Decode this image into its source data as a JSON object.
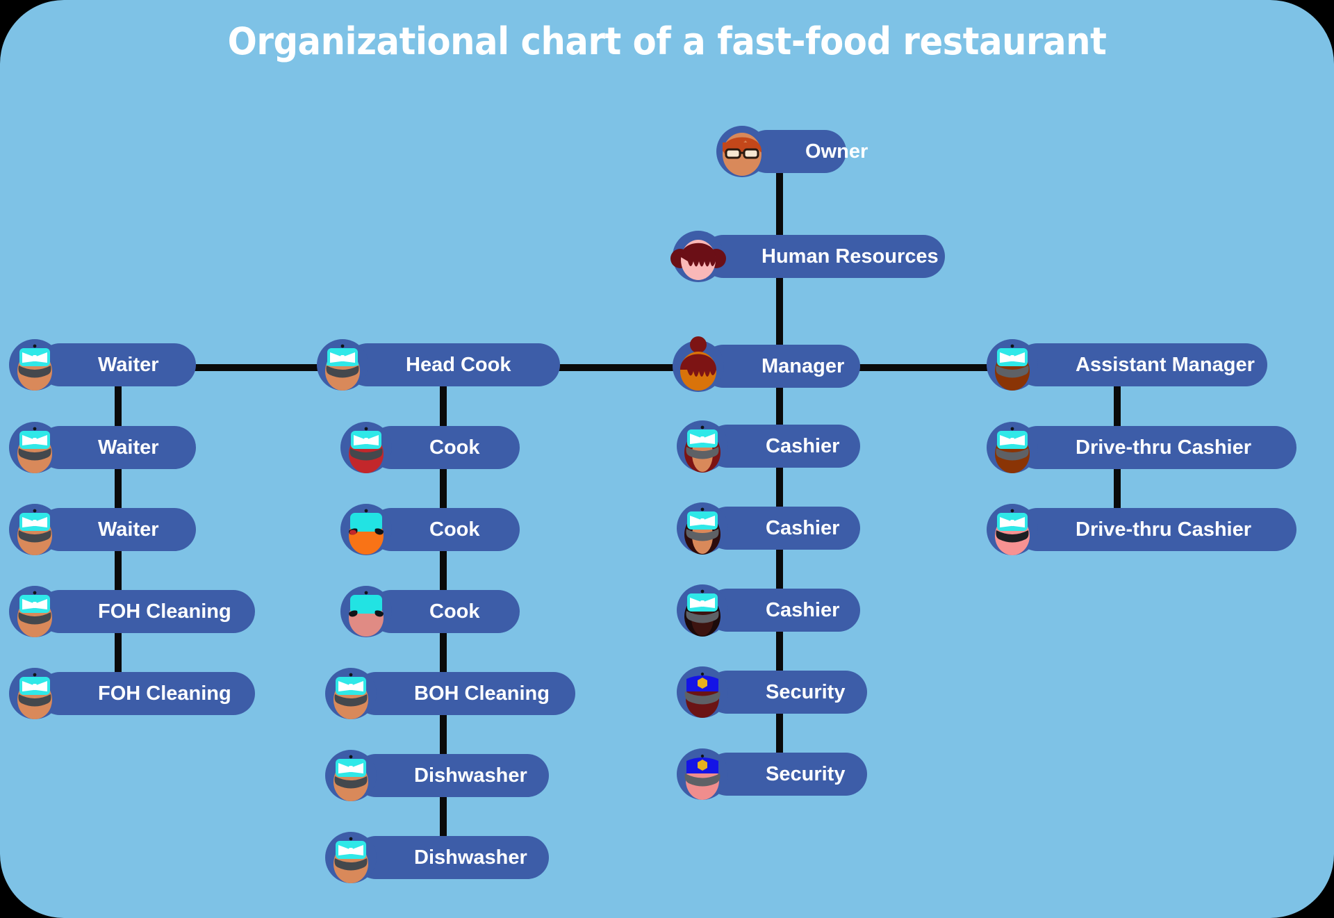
{
  "title": "Organizational chart of a fast-food restaurant",
  "theme": {
    "background": "#7ec2e6",
    "outside": "#000000",
    "pill": "#3d5da8",
    "line": "#0a0a0a",
    "text": "#ffffff"
  },
  "chart_data": {
    "type": "diagram",
    "diagram_kind": "organizational-chart",
    "title": "Organizational chart of a fast-food restaurant",
    "node_count": 23,
    "nodes": [
      {
        "id": "owner",
        "label": "Owner",
        "parent": null,
        "column": "center",
        "level": 0
      },
      {
        "id": "hr",
        "label": "Human Resources",
        "parent": "owner",
        "column": "center",
        "level": 1
      },
      {
        "id": "manager",
        "label": "Manager",
        "parent": "hr",
        "column": "center",
        "level": 2
      },
      {
        "id": "headcook",
        "label": "Head Cook",
        "parent": "manager",
        "column": "kitchen",
        "level": 2
      },
      {
        "id": "waiter1",
        "label": "Waiter",
        "parent": "headcook",
        "column": "foh",
        "level": 2
      },
      {
        "id": "asstmgr",
        "label": "Assistant Manager",
        "parent": "manager",
        "column": "drivethru",
        "level": 2
      },
      {
        "id": "waiter2",
        "label": "Waiter",
        "parent": "waiter1",
        "column": "foh",
        "level": 3
      },
      {
        "id": "waiter3",
        "label": "Waiter",
        "parent": "waiter2",
        "column": "foh",
        "level": 4
      },
      {
        "id": "fohc1",
        "label": "FOH Cleaning",
        "parent": "waiter3",
        "column": "foh",
        "level": 5
      },
      {
        "id": "fohc2",
        "label": "FOH Cleaning",
        "parent": "fohc1",
        "column": "foh",
        "level": 6
      },
      {
        "id": "cook1",
        "label": "Cook",
        "parent": "headcook",
        "column": "kitchen",
        "level": 3
      },
      {
        "id": "cook2",
        "label": "Cook",
        "parent": "cook1",
        "column": "kitchen",
        "level": 4
      },
      {
        "id": "cook3",
        "label": "Cook",
        "parent": "cook2",
        "column": "kitchen",
        "level": 5
      },
      {
        "id": "bohc1",
        "label": "BOH Cleaning",
        "parent": "cook3",
        "column": "kitchen",
        "level": 6
      },
      {
        "id": "dish1",
        "label": "Dishwasher",
        "parent": "bohc1",
        "column": "kitchen",
        "level": 7
      },
      {
        "id": "dish2",
        "label": "Dishwasher",
        "parent": "dish1",
        "column": "kitchen",
        "level": 8
      },
      {
        "id": "cash1",
        "label": "Cashier",
        "parent": "manager",
        "column": "center",
        "level": 3
      },
      {
        "id": "cash2",
        "label": "Cashier",
        "parent": "cash1",
        "column": "center",
        "level": 4
      },
      {
        "id": "cash3",
        "label": "Cashier",
        "parent": "cash2",
        "column": "center",
        "level": 5
      },
      {
        "id": "sec1",
        "label": "Security",
        "parent": "cash3",
        "column": "center",
        "level": 6
      },
      {
        "id": "sec2",
        "label": "Security",
        "parent": "sec1",
        "column": "center",
        "level": 7
      },
      {
        "id": "dtc1",
        "label": "Drive-thru Cashier",
        "parent": "asstmgr",
        "column": "drivethru",
        "level": 3
      },
      {
        "id": "dtc2",
        "label": "Drive-thru Cashier",
        "parent": "dtc1",
        "column": "drivethru",
        "level": 4
      }
    ],
    "edges": [
      {
        "from": "owner",
        "to": "hr"
      },
      {
        "from": "hr",
        "to": "manager"
      },
      {
        "from": "manager",
        "to": "headcook"
      },
      {
        "from": "manager",
        "to": "asstmgr"
      },
      {
        "from": "headcook",
        "to": "waiter1"
      },
      {
        "from": "waiter1",
        "to": "waiter2"
      },
      {
        "from": "waiter2",
        "to": "waiter3"
      },
      {
        "from": "waiter3",
        "to": "fohc1"
      },
      {
        "from": "fohc1",
        "to": "fohc2"
      },
      {
        "from": "headcook",
        "to": "cook1"
      },
      {
        "from": "cook1",
        "to": "cook2"
      },
      {
        "from": "cook2",
        "to": "cook3"
      },
      {
        "from": "cook3",
        "to": "bohc1"
      },
      {
        "from": "bohc1",
        "to": "dish1"
      },
      {
        "from": "dish1",
        "to": "dish2"
      },
      {
        "from": "manager",
        "to": "cash1"
      },
      {
        "from": "cash1",
        "to": "cash2"
      },
      {
        "from": "cash2",
        "to": "cash3"
      },
      {
        "from": "cash3",
        "to": "sec1"
      },
      {
        "from": "sec1",
        "to": "sec2"
      },
      {
        "from": "asstmgr",
        "to": "dtc1"
      },
      {
        "from": "dtc1",
        "to": "dtc2"
      }
    ],
    "columns": [
      "foh",
      "kitchen",
      "center",
      "drivethru"
    ],
    "legend": [],
    "annotations": []
  },
  "nodes": {
    "owner": {
      "label": "Owner",
      "avatar": "avatar-owner-orange-hair-glasses"
    },
    "hr": {
      "label": "Human Resources",
      "avatar": "avatar-hr-darkred-buns"
    },
    "manager": {
      "label": "Manager",
      "avatar": "avatar-manager-bun"
    },
    "headcook": {
      "label": "Head Cook",
      "avatar": "avatar-cap-bow-tan"
    },
    "waiter1": {
      "label": "Waiter",
      "avatar": "avatar-cap-bow-tan"
    },
    "waiter2": {
      "label": "Waiter",
      "avatar": "avatar-cap-bow-tan"
    },
    "waiter3": {
      "label": "Waiter",
      "avatar": "avatar-cap-bow-tan"
    },
    "fohc1": {
      "label": "FOH Cleaning",
      "avatar": "avatar-cap-bow-tan"
    },
    "fohc2": {
      "label": "FOH Cleaning",
      "avatar": "avatar-cap-bow-tan"
    },
    "cook1": {
      "label": "Cook",
      "avatar": "avatar-cap-bow-red"
    },
    "cook2": {
      "label": "Cook",
      "avatar": "avatar-cap-plain-orange-glasses"
    },
    "cook3": {
      "label": "Cook",
      "avatar": "avatar-cap-plain-pink-glasses"
    },
    "bohc1": {
      "label": "BOH Cleaning",
      "avatar": "avatar-cap-bow-tan"
    },
    "dish1": {
      "label": "Dishwasher",
      "avatar": "avatar-cap-bow-tan"
    },
    "dish2": {
      "label": "Dishwasher",
      "avatar": "avatar-cap-bow-tan"
    },
    "cash1": {
      "label": "Cashier",
      "avatar": "avatar-cap-bow-longhair-red"
    },
    "cash2": {
      "label": "Cashier",
      "avatar": "avatar-cap-bow-longhair-brown"
    },
    "cash3": {
      "label": "Cashier",
      "avatar": "avatar-cap-bow-darkskin"
    },
    "sec1": {
      "label": "Security",
      "avatar": "avatar-police-cap-darkred"
    },
    "sec2": {
      "label": "Security",
      "avatar": "avatar-police-cap-pink"
    },
    "asstmgr": {
      "label": "Assistant Manager",
      "avatar": "avatar-cap-bow-darkbrown"
    },
    "dtc1": {
      "label": "Drive-thru Cashier",
      "avatar": "avatar-cap-bow-darkbrown"
    },
    "dtc2": {
      "label": "Drive-thru Cashier",
      "avatar": "avatar-cap-bow-pink"
    }
  }
}
